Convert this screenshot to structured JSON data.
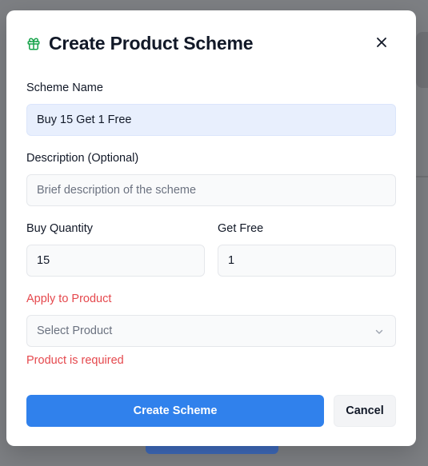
{
  "dialog": {
    "title": "Create Product Scheme",
    "icon": "gift-icon",
    "accent_color": "#16a34a",
    "close_icon": "close-icon"
  },
  "form": {
    "scheme_name": {
      "label": "Scheme Name",
      "value": "Buy 15 Get 1 Free"
    },
    "description": {
      "label": "Description (Optional)",
      "placeholder": "Brief description of the scheme",
      "value": ""
    },
    "buy_quantity": {
      "label": "Buy Quantity",
      "value": "15"
    },
    "get_free": {
      "label": "Get Free",
      "value": "1"
    },
    "product": {
      "label": "Apply to Product",
      "selected": "Select Product",
      "error": "Product is required",
      "error_color": "#e5484d"
    }
  },
  "actions": {
    "create_label": "Create Scheme",
    "cancel_label": "Cancel",
    "primary_color": "#3081ec"
  }
}
